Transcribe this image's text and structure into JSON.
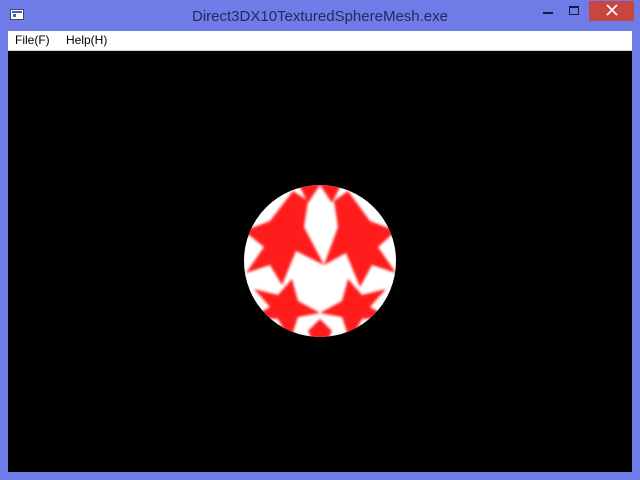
{
  "window": {
    "title": "Direct3DX10TexturedSphereMesh.exe",
    "titlebar_color": "#6f7ce8",
    "close_button_color": "#c74640"
  },
  "menu": {
    "items": [
      {
        "label": "File(F)"
      },
      {
        "label": "Help(H)"
      }
    ]
  },
  "viewport": {
    "background_color": "#000000",
    "sphere": {
      "base_color": "#ffffff",
      "pattern_color": "#ff1a1a"
    }
  },
  "icons": {
    "app": "app-window-icon",
    "minimize": "minimize-icon",
    "maximize": "maximize-icon",
    "close": "close-icon"
  }
}
